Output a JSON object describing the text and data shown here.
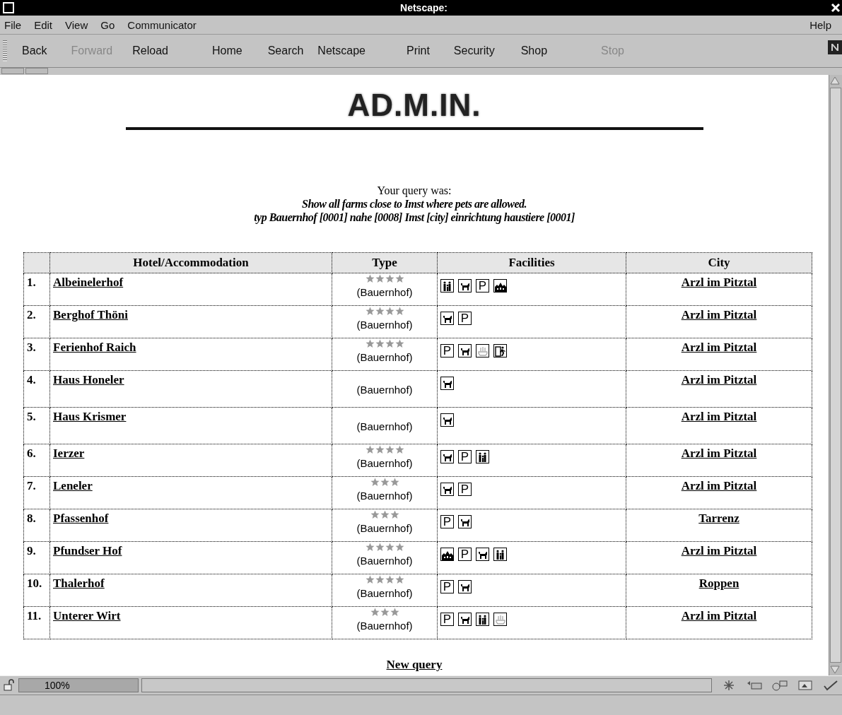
{
  "window": {
    "title": "Netscape:"
  },
  "menu": {
    "items": [
      "File",
      "Edit",
      "View",
      "Go",
      "Communicator"
    ],
    "help": "Help"
  },
  "toolbar": [
    {
      "label": "Back",
      "disabled": false
    },
    {
      "label": "Forward",
      "disabled": true
    },
    {
      "label": "Reload",
      "disabled": false
    },
    {
      "label": "Home",
      "disabled": false
    },
    {
      "label": "Search",
      "disabled": false
    },
    {
      "label": "Netscape",
      "disabled": false
    },
    {
      "label": "Print",
      "disabled": false
    },
    {
      "label": "Security",
      "disabled": false
    },
    {
      "label": "Shop",
      "disabled": false
    },
    {
      "label": "Stop",
      "disabled": true
    }
  ],
  "page": {
    "heading": "AD.M.IN.",
    "query_label": "Your query was:",
    "query_text": "Show all farms close to Imst where pets are allowed.",
    "query_code": "typ Bauernhof [0001] nahe [0008] Imst [city] einrichtung haustiere [0001]"
  },
  "table": {
    "columns": [
      "Hotel/Accommodation",
      "Type",
      "Facilities",
      "City"
    ],
    "rows": [
      {
        "number": "1.",
        "name": "Albeinelerhof",
        "stars": 4,
        "type": "(Bauernhof)",
        "facilities": [
          {
            "kind": "family"
          },
          {
            "kind": "pet"
          },
          {
            "kind": "parking",
            "text": "P"
          },
          {
            "kind": "group"
          }
        ],
        "city": "Arzl im Pitztal"
      },
      {
        "number": "2.",
        "name": "Berghof Thöni",
        "stars": 4,
        "type": "(Bauernhof)",
        "facilities": [
          {
            "kind": "pet"
          },
          {
            "kind": "parking",
            "text": "P"
          }
        ],
        "city": "Arzl im Pitztal"
      },
      {
        "number": "3.",
        "name": "Ferienhof Raich",
        "stars": 4,
        "type": "(Bauernhof)",
        "facilities": [
          {
            "kind": "parking",
            "text": "P"
          },
          {
            "kind": "pet"
          },
          {
            "kind": "bath"
          },
          {
            "kind": "door"
          }
        ],
        "city": "Arzl im Pitztal"
      },
      {
        "number": "4.",
        "name": "Haus Honeler",
        "stars": 0,
        "type": "(Bauernhof)",
        "facilities": [
          {
            "kind": "pet"
          }
        ],
        "city": "Arzl im Pitztal"
      },
      {
        "number": "5.",
        "name": "Haus Krismer",
        "stars": 0,
        "type": "(Bauernhof)",
        "facilities": [
          {
            "kind": "pet"
          }
        ],
        "city": "Arzl im Pitztal"
      },
      {
        "number": "6.",
        "name": "Ierzer",
        "stars": 4,
        "type": "(Bauernhof)",
        "facilities": [
          {
            "kind": "pet"
          },
          {
            "kind": "parking",
            "text": "P"
          },
          {
            "kind": "family"
          }
        ],
        "city": "Arzl im Pitztal"
      },
      {
        "number": "7.",
        "name": "Leneler",
        "stars": 3,
        "type": "(Bauernhof)",
        "facilities": [
          {
            "kind": "pet"
          },
          {
            "kind": "parking",
            "text": "P"
          }
        ],
        "city": "Arzl im Pitztal"
      },
      {
        "number": "8.",
        "name": "Pfassenhof",
        "stars": 3,
        "type": "(Bauernhof)",
        "facilities": [
          {
            "kind": "parking",
            "text": "P"
          },
          {
            "kind": "pet"
          }
        ],
        "city": "Tarrenz"
      },
      {
        "number": "9.",
        "name": "Pfundser Hof",
        "stars": 4,
        "type": "(Bauernhof)",
        "facilities": [
          {
            "kind": "group"
          },
          {
            "kind": "parking",
            "text": "P"
          },
          {
            "kind": "pet"
          },
          {
            "kind": "family"
          }
        ],
        "city": "Arzl im Pitztal"
      },
      {
        "number": "10.",
        "name": "Thalerhof",
        "stars": 4,
        "type": "(Bauernhof)",
        "facilities": [
          {
            "kind": "parking",
            "text": "P"
          },
          {
            "kind": "pet"
          }
        ],
        "city": "Roppen"
      },
      {
        "number": "11.",
        "name": "Unterer Wirt",
        "stars": 3,
        "type": "(Bauernhof)",
        "facilities": [
          {
            "kind": "parking",
            "text": "P"
          },
          {
            "kind": "pet"
          },
          {
            "kind": "family"
          },
          {
            "kind": "bath"
          }
        ],
        "city": "Arzl im Pitztal"
      }
    ]
  },
  "new_query": "New query",
  "status_bar": {
    "zoom": "100%"
  }
}
